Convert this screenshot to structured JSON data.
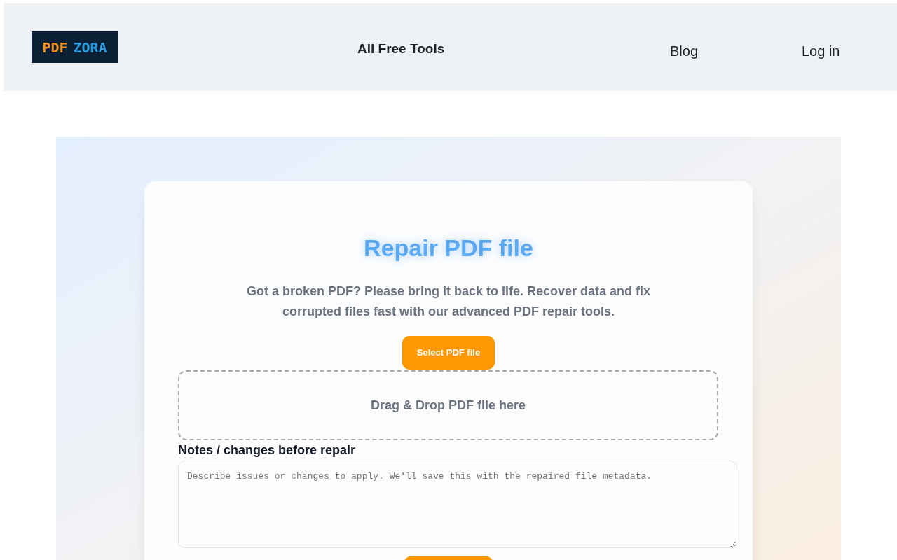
{
  "header": {
    "logo": [
      "PDF",
      "ZORA"
    ],
    "nav": [
      "All Free Tools",
      "Blog",
      "Log in"
    ]
  },
  "tool": {
    "title": "Repair PDF file",
    "description": "Got a broken PDF? Please bring it back to life. Recover data and fix corrupted files fast with our advanced PDF repair tools.",
    "select_button": "Select PDF file",
    "dropzone": "Drag & Drop PDF file here",
    "notes_label": "Notes / changes before repair",
    "notes_placeholder": "Describe issues or changes to apply. We'll save this with the repaired file metadata."
  }
}
